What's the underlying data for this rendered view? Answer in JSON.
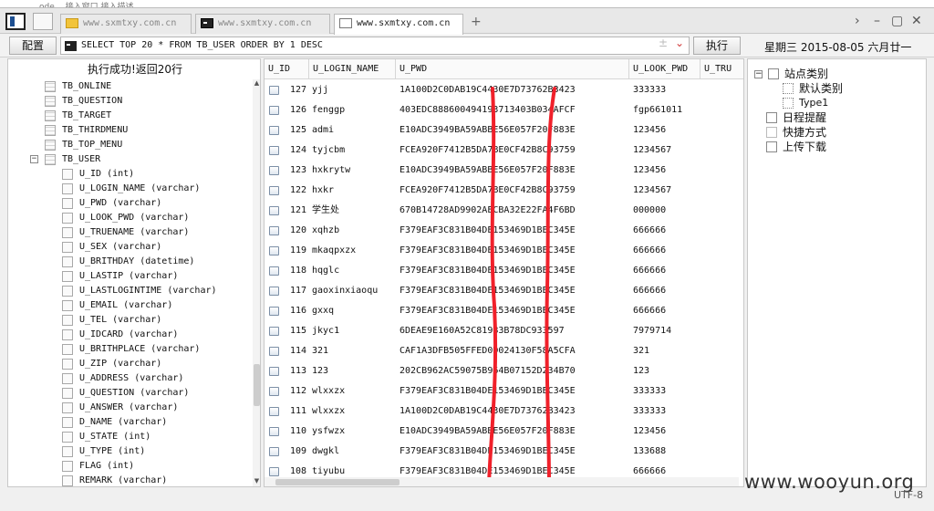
{
  "tabs": [
    {
      "label": "www.sxmtxy.com.cn",
      "icon": "folder-icon",
      "active": false
    },
    {
      "label": "www.sxmtxy.com.cn",
      "icon": "console-icon",
      "active": false
    },
    {
      "label": "www.sxmtxy.com.cn",
      "icon": "page-icon",
      "active": true
    }
  ],
  "tabbar": {
    "add_label": "+",
    "overflow_label": "›",
    "minimize_label": "–",
    "maximize_label": "▢",
    "close_label": "✕"
  },
  "query": {
    "config_label": "配置",
    "sql": "SELECT TOP 20 * FROM TB_USER ORDER BY 1 DESC",
    "history_label": "±",
    "dropdown_label": "⌄",
    "execute_label": "执行",
    "date_label": "星期三  2015-08-05  六月廿一"
  },
  "status": "执行成功!返回20行",
  "tree": {
    "tables": [
      {
        "name": "TB_ONLINE"
      },
      {
        "name": "TB_QUESTION"
      },
      {
        "name": "TB_TARGET"
      },
      {
        "name": "TB_THIRDMENU"
      },
      {
        "name": "TB_TOP_MENU"
      },
      {
        "name": "TB_USER",
        "expander": "−"
      }
    ],
    "columns": [
      "U_ID (int)",
      "U_LOGIN_NAME (varchar)",
      "U_PWD (varchar)",
      "U_LOOK_PWD (varchar)",
      "U_TRUENAME (varchar)",
      "U_SEX (varchar)",
      "U_BRITHDAY (datetime)",
      "U_LASTIP (varchar)",
      "U_LASTLOGINTIME (varchar)",
      "U_EMAIL (varchar)",
      "U_TEL (varchar)",
      "U_IDCARD (varchar)",
      "U_BRITHPLACE (varchar)",
      "U_ZIP (varchar)",
      "U_ADDRESS (varchar)",
      "U_QUESTION (varchar)",
      "U_ANSWER (varchar)",
      "D_NAME (varchar)",
      "U_STATE (int)",
      "U_TYPE (int)",
      "FLAG (int)",
      "REMARK (varchar)"
    ]
  },
  "grid": {
    "columns": [
      "U_ID",
      "U_LOGIN_NAME",
      "U_PWD",
      "U_LOOK_PWD",
      "U_TRU"
    ],
    "rows": [
      {
        "id": "127",
        "login": "yjj",
        "pwd": "1A100D2C0DAB19C4430E7D73762B3423",
        "look": "333333"
      },
      {
        "id": "126",
        "login": "fenggp",
        "pwd": "403EDC888600494193713403B034AFCF",
        "look": "fgp661011"
      },
      {
        "id": "125",
        "login": "admi",
        "pwd": "E10ADC3949BA59ABBE56E057F20F883E",
        "look": "123456"
      },
      {
        "id": "124",
        "login": "tyjcbm",
        "pwd": "FCEA920F7412B5DA7BE0CF42B8C93759",
        "look": "1234567"
      },
      {
        "id": "123",
        "login": "hxkrytw",
        "pwd": "E10ADC3949BA59ABBE56E057F20F883E",
        "look": "123456"
      },
      {
        "id": "122",
        "login": "hxkr",
        "pwd": "FCEA920F7412B5DA7BE0CF42B8C93759",
        "look": "1234567"
      },
      {
        "id": "121",
        "login": "学生处",
        "pwd": "670B14728AD9902AECBA32E22FA4F6BD",
        "look": "000000"
      },
      {
        "id": "120",
        "login": "xqhzb",
        "pwd": "F379EAF3C831B04DE153469D1BEC345E",
        "look": "666666"
      },
      {
        "id": "119",
        "login": "mkaqpxzx",
        "pwd": "F379EAF3C831B04DE153469D1BEC345E",
        "look": "666666"
      },
      {
        "id": "118",
        "login": "hqglc",
        "pwd": "F379EAF3C831B04DE153469D1BEC345E",
        "look": "666666"
      },
      {
        "id": "117",
        "login": "gaoxinxiaoqu",
        "pwd": "F379EAF3C831B04DE153469D1BEC345E",
        "look": "666666"
      },
      {
        "id": "116",
        "login": "gxxq",
        "pwd": "F379EAF3C831B04DE153469D1BEC345E",
        "look": "666666"
      },
      {
        "id": "115",
        "login": "jkyc1",
        "pwd": "6DEAE9E160A52C81983B78DC933597",
        "look": "7979714"
      },
      {
        "id": "114",
        "login": "321",
        "pwd": "CAF1A3DFB505FFED0D024130F58A5CFA",
        "look": "321"
      },
      {
        "id": "113",
        "login": "123",
        "pwd": "202CB962AC59075B964B07152D234B70",
        "look": "123"
      },
      {
        "id": "112",
        "login": "wlxxzx",
        "pwd": "F379EAF3C831B04DE153469D1BEC345E",
        "look": "333333"
      },
      {
        "id": "111",
        "login": "wlxxzx",
        "pwd": "1A100D2C0DAB19C4430E7D73762B3423",
        "look": "333333"
      },
      {
        "id": "110",
        "login": "ysfwzx",
        "pwd": "E10ADC3949BA59ABBE56E057F20F883E",
        "look": "123456"
      },
      {
        "id": "109",
        "login": "dwgkl",
        "pwd": "F379EAF3C831B04DE153469D1BEC345E",
        "look": "133688"
      },
      {
        "id": "108",
        "login": "tiyubu",
        "pwd": "F379EAF3C831B04DE153469D1BEC345E",
        "look": "666666"
      }
    ]
  },
  "right_panel": {
    "expander": "−",
    "items": [
      {
        "label": "站点类别"
      },
      {
        "label": "默认类别"
      },
      {
        "label": "Type1"
      },
      {
        "label": "日程提醒"
      },
      {
        "label": "快捷方式"
      },
      {
        "label": "上传下载"
      }
    ]
  },
  "watermark": "www.wooyun.org",
  "encoding": "UTF-8",
  "background_fragments": {
    "top": "…ode…  接入窗口  接入描述",
    "side": [
      "E",
      "S",
      "码"
    ]
  },
  "colors": {
    "redaction_stroke": "#f0202a",
    "window_bg": "#f0f0f0",
    "panel_bg": "#ffffff",
    "folder_icon": "#f2c43b"
  }
}
